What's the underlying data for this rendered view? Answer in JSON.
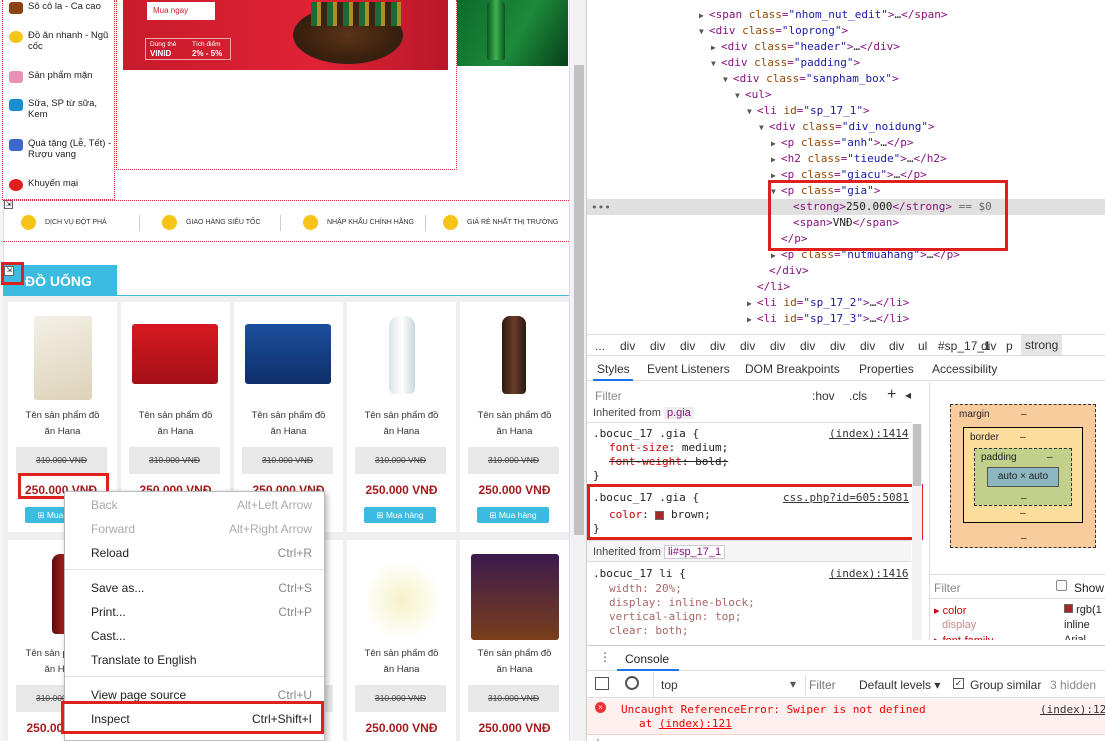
{
  "page": {
    "sidebar": [
      {
        "label": "Sô cô la - Ca cao",
        "color": "#8b4513"
      },
      {
        "label": "Đồ ăn nhanh - Ngũ cốc",
        "color": "#f6c417"
      },
      {
        "label": "Sản phẩm mặn",
        "color": "#e891b6"
      },
      {
        "label": "Sữa, SP từ sữa, Kem",
        "color": "#1b8ed1"
      },
      {
        "label": "Quà tặng (Lễ, Tết) - Rượu vang",
        "color": "#3d67c9"
      },
      {
        "label": "Khuyến mại",
        "color": "#e02020"
      }
    ],
    "banner": {
      "buy_label": "Mua ngay",
      "pay1": "Dùng thẻ",
      "pay2": "VINID",
      "pay3": "Tích điểm",
      "pay4": "2% - 5%"
    },
    "services": [
      {
        "label": "DỊCH VỤ ĐỘT PHÁ"
      },
      {
        "label": "GIAO HÀNG SIÊU TỐC"
      },
      {
        "label": "NHẬP KHẨU CHÍNH HÃNG"
      },
      {
        "label": "GIÁ RẺ NHẤT THỊ TRƯỜNG"
      }
    ],
    "section_title": "ĐỒ UỐNG",
    "product_name_line1": "Tên sản phẩm đồ",
    "product_name_line2": "ăn Hana",
    "old_price": "310.000 VNĐ",
    "price": "250.000 VNĐ",
    "buy_label": "Mua hàng"
  },
  "context_menu": [
    {
      "label": "Back",
      "shortcut": "Alt+Left Arrow",
      "disabled": true
    },
    {
      "label": "Forward",
      "shortcut": "Alt+Right Arrow",
      "disabled": true
    },
    {
      "label": "Reload",
      "shortcut": "Ctrl+R",
      "disabled": false
    },
    {
      "label": "Save as...",
      "shortcut": "Ctrl+S",
      "disabled": false
    },
    {
      "label": "Print...",
      "shortcut": "Ctrl+P",
      "disabled": false
    },
    {
      "label": "Cast...",
      "shortcut": "",
      "disabled": false
    },
    {
      "label": "Translate to English",
      "shortcut": "",
      "disabled": false
    },
    {
      "label": "View page source",
      "shortcut": "Ctrl+U",
      "disabled": false
    },
    {
      "label": "Inspect",
      "shortcut": "Ctrl+Shift+I",
      "disabled": false
    }
  ],
  "devtools": {
    "dom": {
      "l1_tag": "span",
      "l1_cls": "nhom_nut_edit",
      "l2_tag": "div",
      "l2_cls": "loprong",
      "l3_tag": "div",
      "l3_cls": "header",
      "l4_tag": "div",
      "l4_cls": "padding",
      "l5_tag": "div",
      "l5_cls": "sanpham_box",
      "l6_tag": "ul",
      "l7_tag": "li",
      "l7_id": "sp_17_1",
      "l8_tag": "div",
      "l8_cls": "div_noidung",
      "l9_tag": "p",
      "l9_cls": "anh",
      "l10_tag": "h2",
      "l10_cls": "tieude",
      "l11_tag": "p",
      "l11_cls": "giacu",
      "l12_tag": "p",
      "l12_cls": "gia",
      "strong_text": "250.000",
      "selected_marker": "== $0",
      "span_text": "VNĐ",
      "l16_cls": "nutmuahang",
      "l17_id": "sp_17_2",
      "l18_id": "sp_17_3",
      "ellipsis": "…"
    },
    "breadcrumbs": [
      "...",
      "div",
      "div",
      "div",
      "div",
      "div",
      "div",
      "div",
      "div",
      "div",
      "div",
      "ul",
      "#sp_17_1",
      "div",
      "p",
      "strong"
    ],
    "tabs": [
      "Styles",
      "Event Listeners",
      "DOM Breakpoints",
      "Properties",
      "Accessibility"
    ],
    "styles": {
      "filter_placeholder": "Filter",
      "hov": ":hov",
      "cls": ".cls",
      "plus": "+",
      "inherited_from_1_label": "Inherited from",
      "inherited_from_1_target": "p.gia",
      "rule1_selector": ".bocuc_17 .gia {",
      "rule1_source": "(index):1414",
      "rule1_p1_name": "font-size",
      "rule1_p1_value": "medium;",
      "rule1_p2_name": "font-weight",
      "rule1_p2_value": "bold;",
      "close": "}",
      "rule2_selector": ".bocuc_17 .gia {",
      "rule2_source": "css.php?id=605:5081",
      "rule2_p1_name": "color",
      "rule2_p1_value": "brown;",
      "swatch_color": "#a52a2a",
      "inherited_from_2_label": "Inherited from",
      "inherited_from_2_target": "li#sp_17_1",
      "rule3_selector": ".bocuc_17 li {",
      "rule3_source": "(index):1416",
      "rule3_p1_name": "width",
      "rule3_p1_value": "20%;",
      "rule3_p2_name": "display",
      "rule3_p2_value": "inline-block;",
      "rule3_p3_name": "vertical-align",
      "rule3_p3_value": "top;",
      "rule3_p4_name": "clear",
      "rule3_p4_value": "both;"
    },
    "box_model": {
      "margin_label": "margin",
      "border_label": "border",
      "padding_label": "padding",
      "content": "auto × auto",
      "dash": "–",
      "filter_label": "Filter",
      "show_label": "Show",
      "computed": [
        {
          "name": "color",
          "value": "rgb(1"
        },
        {
          "name": "display",
          "value": "inline"
        },
        {
          "name": "font-family",
          "value": "Arial"
        }
      ]
    },
    "console": {
      "tab_label": "Console",
      "context": "top",
      "filter": "Filter",
      "levels": "Default levels",
      "group_similar": "Group similar",
      "hidden": "3 hidden",
      "error_text": "Uncaught ReferenceError: Swiper is not defined",
      "error_at": "at",
      "error_link": "(index):121",
      "error_source": "(index):12"
    }
  }
}
